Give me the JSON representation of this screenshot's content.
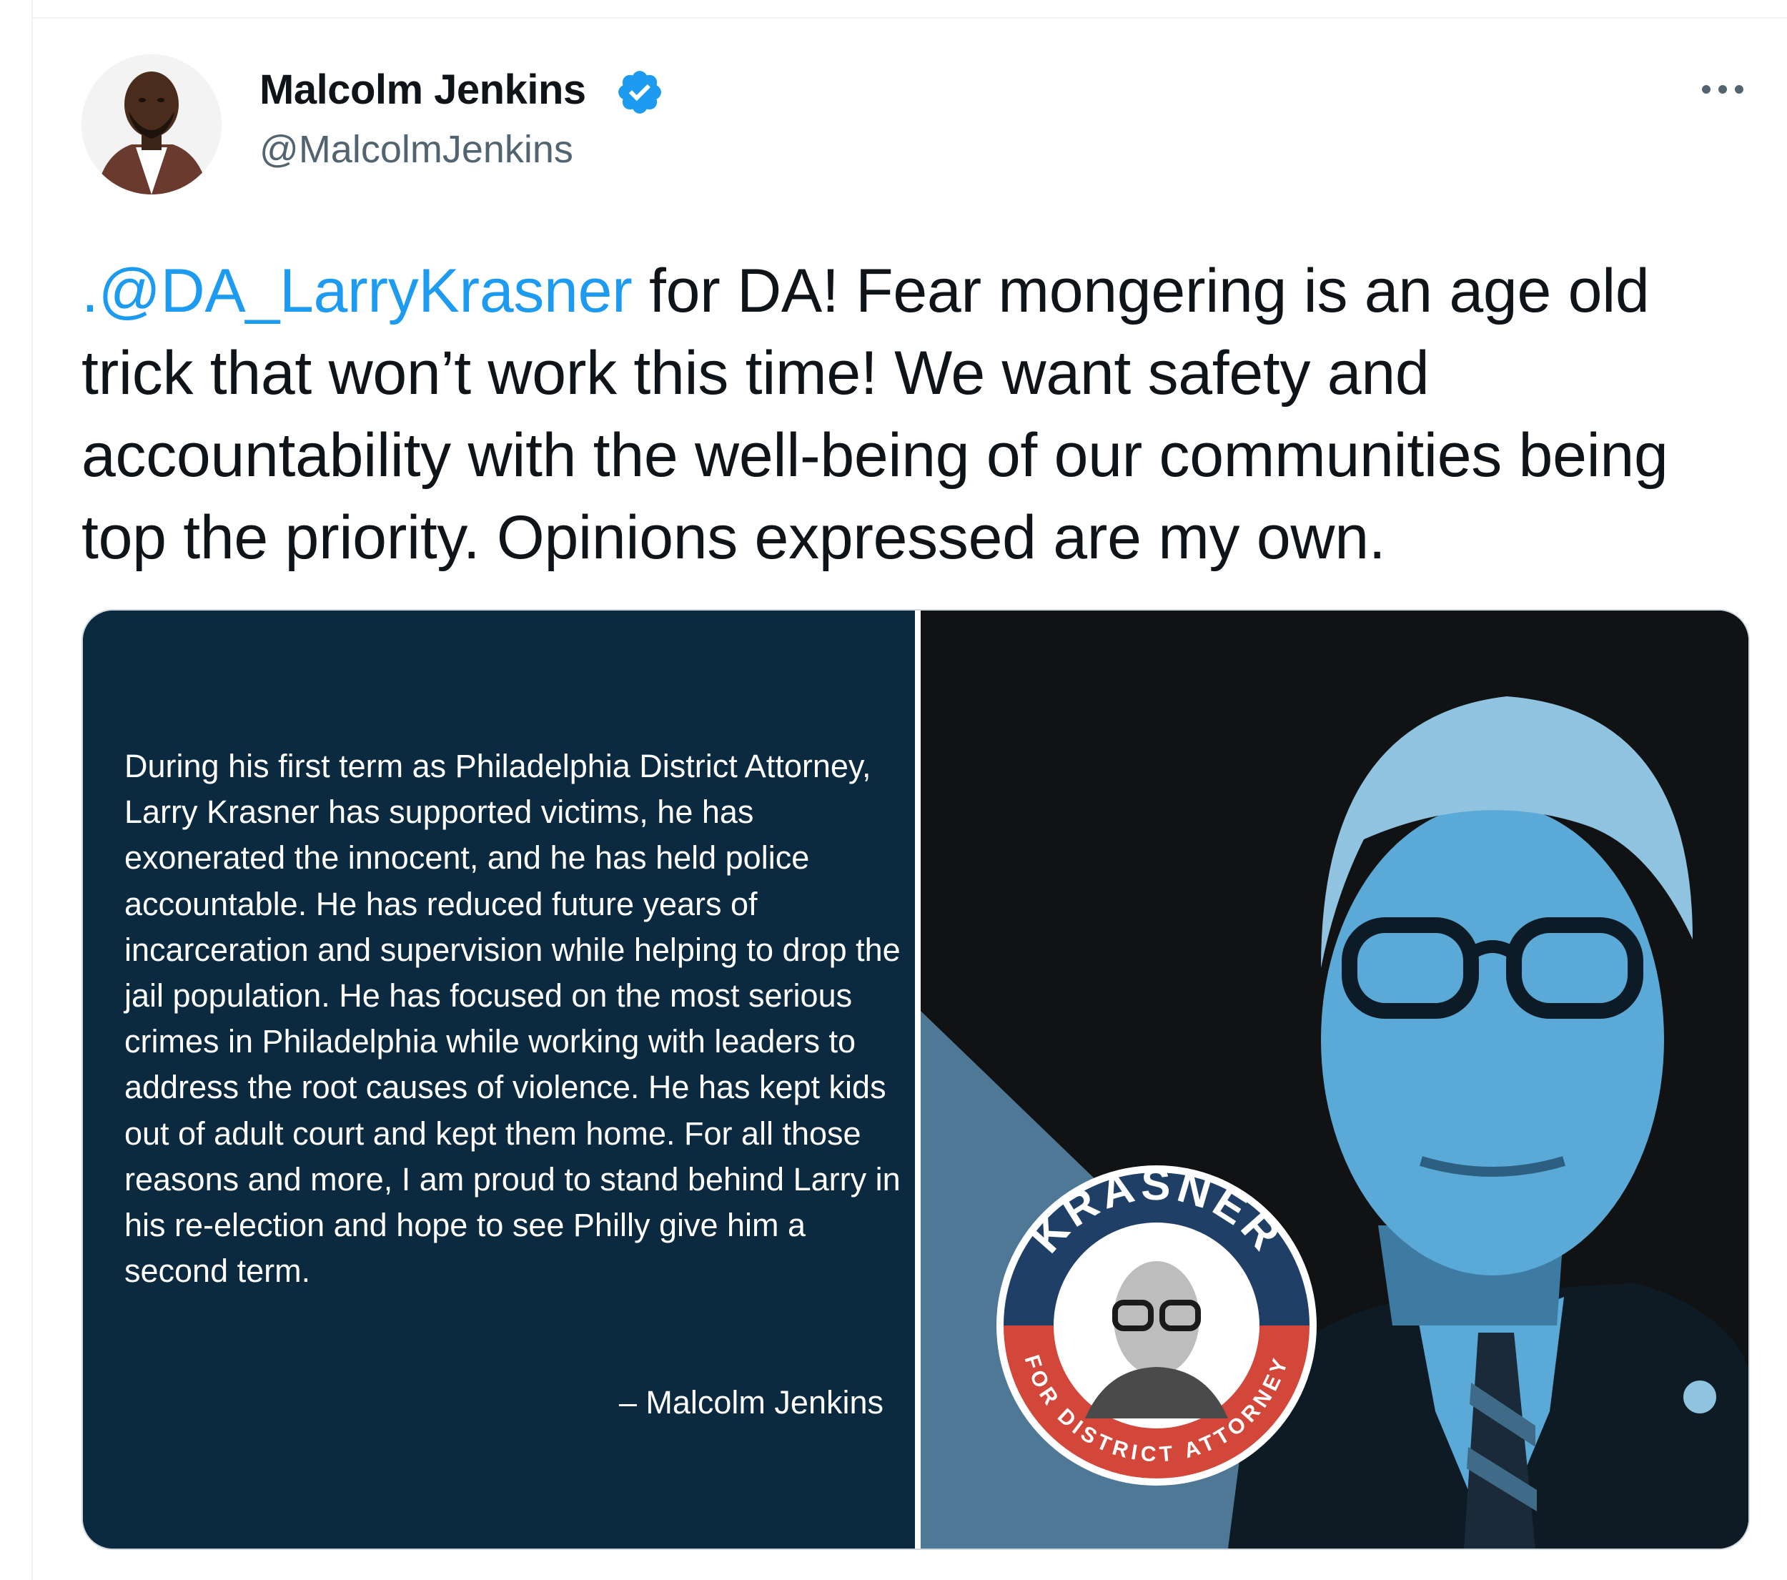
{
  "author": {
    "name": "Malcolm Jenkins",
    "handle": "@MalcolmJenkins"
  },
  "tweet": {
    "mention": ".@DA_LarryKrasner",
    "text": " for DA! Fear mongering is an age old trick that won’t work this time! We want safety and accountability with the well-being of our communities being top the priority. Opinions expressed are my own."
  },
  "media": {
    "quote": "During his first term as Philadelphia District Attorney, Larry Krasner has supported victims, he has exonerated the innocent, and he has held police accountable. He has reduced future years of incarceration and supervision while helping to drop the jail population. He has focused on the most serious crimes in Philadelphia while working with leaders to address the root causes of violence. He has kept kids out of adult court and kept them home. For all those reasons and more, I am proud to stand behind Larry in his re-election and hope to see Philly give him a second term.",
    "attribution": "– Malcolm Jenkins",
    "badge_top": "KRASNER",
    "badge_bottom": "FOR DISTRICT ATTORNEY"
  },
  "icons": {
    "verified": "verified-badge-icon",
    "more": "more-options-icon"
  },
  "colors": {
    "link": "#1d9bf0",
    "verified": "#1d9bf0",
    "quote_panel_bg": "#0b2a40",
    "photo_tint": "#5aa9d6",
    "badge_blue": "#1f3f66",
    "badge_red": "#d2473a"
  }
}
